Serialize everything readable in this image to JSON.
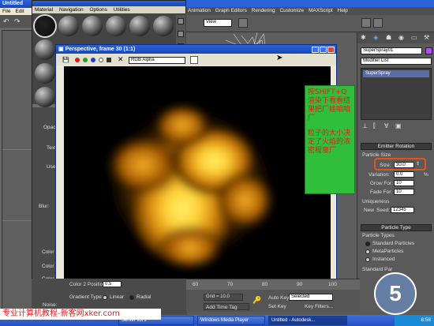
{
  "left_app": {
    "title": "Untitled",
    "menu": [
      "File",
      "Edit"
    ]
  },
  "material_editor": {
    "menu": [
      "Material",
      "Navigation",
      "Options",
      "Utilities"
    ]
  },
  "main_menu": [
    "Animation",
    "Graph Editors",
    "Rendering",
    "Customize",
    "MAXScript",
    "Help"
  ],
  "viewport_dropdown": "View",
  "render_window": {
    "title": "Perspective, frame 30 (1:1)",
    "channel": "RGB Alpha",
    "title_buttons": [
      "_",
      "□",
      "X"
    ]
  },
  "annotation": {
    "line1": "按SHIFT+Q渲染下看看结果把厂娃咱咱厂",
    "line2": "粒子的大小决定了火焰的浓密程度厂"
  },
  "right_panel": {
    "object_name": "SuperSpray01",
    "modifier_list": "Modifier List",
    "stack_item": "SuperSpray",
    "emitter_rotation": "Emitter Rotation",
    "particle_size_label": "Particle Size",
    "size_label": "Size:",
    "size_value": "30.0",
    "variation_label": "Variation:",
    "variation_value": "0.0",
    "variation_unit": "%",
    "grow_for_label": "Grow For:",
    "grow_for_value": "10",
    "fade_for_label": "Fade For:",
    "fade_for_value": "10",
    "uniqueness_label": "Uniqueness",
    "new_label": "New",
    "seed_label": "Seed:",
    "seed_value": "12345",
    "particle_type_rollout": "Particle Type",
    "particle_types_label": "Particle Types",
    "types": [
      "Standard Particles",
      "MetaParticles",
      "Instanced"
    ],
    "standard_particles_label": "Standard Par"
  },
  "left_params": {
    "opacity": "Opacity:",
    "texture_label": "Text",
    "use_label": "Use I",
    "blur_label": "Blur:",
    "color_a": "Color #",
    "color_b": "Color #",
    "color_c": "Color #",
    "color2_position_label": "Color 2 Position:",
    "color2_position_value": "0.5",
    "gradient_type_label": "Gradient Type:",
    "gradient_linear": "Linear",
    "gradient_radial": "Radial",
    "noise_label": "Noise:"
  },
  "timeline": {
    "ticks": [
      "60",
      "70",
      "80",
      "90",
      "100"
    ],
    "grid": "Grid = 10.0",
    "add_time_tag": "Add Time Tag",
    "auto_key": "Auto Key",
    "selected": "Selected",
    "set_key": "Set Key",
    "key_filters": "Key Filters..."
  },
  "taskbar": {
    "items": [
      "Server vol 2",
      "Windows Media Player",
      "Untitled - Autodesk..."
    ],
    "clock": "8:58"
  },
  "watermark": {
    "text": "专业计算机教程-新客网xker.com",
    "logo_text": "5"
  },
  "colors": {
    "xp_title": "#2b62d8",
    "annotation_bg": "#2fbf3a",
    "annotation_text": "#e81b1b",
    "highlight_box": "#e2541b",
    "fire_core": "#ffd23a"
  }
}
